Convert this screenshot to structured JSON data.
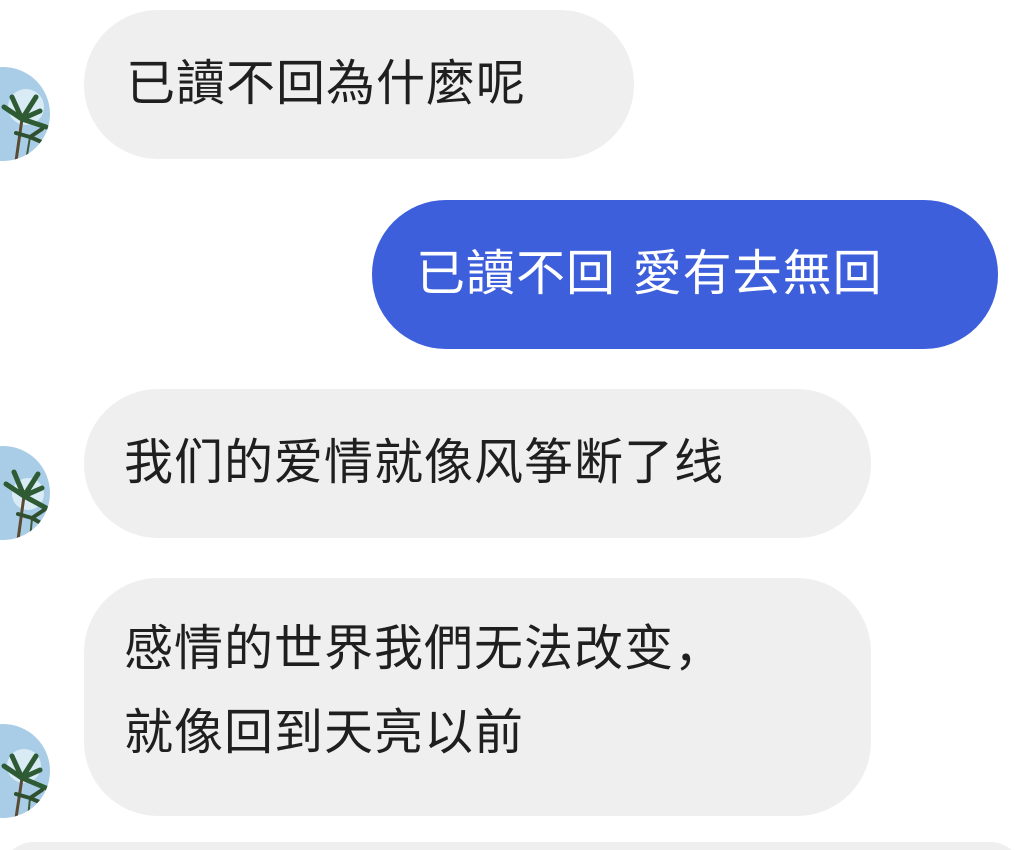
{
  "conversation": {
    "messages": [
      {
        "direction": "incoming",
        "text": "已讀不回為什麼呢"
      },
      {
        "direction": "outgoing",
        "text": "已讀不回 愛有去無回"
      },
      {
        "direction": "incoming",
        "text": "我们的爱情就像风筝断了线"
      },
      {
        "direction": "incoming",
        "lines": [
          "感情的世界我們无法改变，",
          "就像回到天亮以前"
        ]
      }
    ],
    "avatar_icon": "palm-tree-sky-avatar-icon"
  },
  "colors": {
    "incoming_bubble": "#efefef",
    "outgoing_bubble": "#3d5fdb",
    "incoming_text": "#1f1f1f",
    "outgoing_text": "#ffffff"
  }
}
